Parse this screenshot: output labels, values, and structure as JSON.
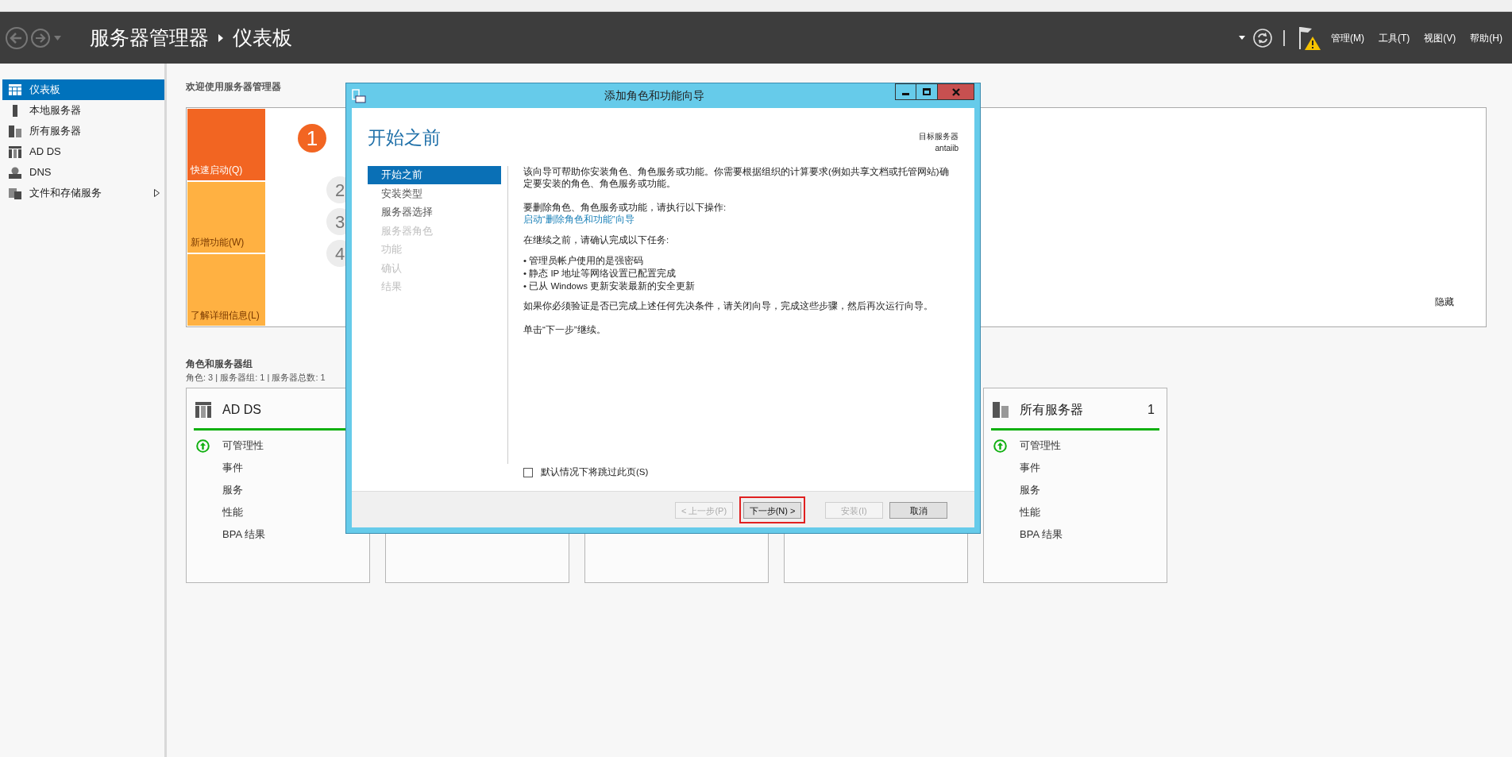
{
  "header": {
    "breadcrumb": [
      "服务器管理器",
      "仪表板"
    ],
    "menus": [
      "管理(M)",
      "工具(T)",
      "视图(V)",
      "帮助(H)"
    ]
  },
  "sidebar": {
    "items": [
      {
        "label": "仪表板",
        "selected": true,
        "expandable": false
      },
      {
        "label": "本地服务器",
        "selected": false,
        "expandable": false
      },
      {
        "label": "所有服务器",
        "selected": false,
        "expandable": false
      },
      {
        "label": "AD DS",
        "selected": false,
        "expandable": false
      },
      {
        "label": "DNS",
        "selected": false,
        "expandable": false
      },
      {
        "label": "文件和存储服务",
        "selected": false,
        "expandable": true
      }
    ]
  },
  "welcome": {
    "title": "欢迎使用服务器管理器",
    "quick_tiles": [
      {
        "label": "快速启动(Q)",
        "selected": true
      },
      {
        "label": "新增功能(W)",
        "selected": false
      },
      {
        "label": "了解详细信息(L)",
        "selected": false
      }
    ],
    "steps": [
      {
        "number": "1",
        "selected": true
      },
      {
        "number": "2",
        "selected": false
      },
      {
        "number": "3",
        "selected": false
      },
      {
        "number": "4",
        "selected": false
      }
    ],
    "hide_link": "隐藏"
  },
  "roles": {
    "title": "角色和服务器组",
    "summary": "角色: 3 | 服务器组: 1 | 服务器总数: 1",
    "tiles": [
      {
        "title": "AD DS",
        "rows": [
          {
            "label": "可管理性",
            "ok": true
          },
          {
            "label": "事件",
            "ok": false
          },
          {
            "label": "服务",
            "ok": false
          },
          {
            "label": "性能",
            "ok": false
          },
          {
            "label": "BPA 结果",
            "ok": false
          }
        ]
      },
      {
        "title": "所有服务器",
        "count": "1",
        "rows": [
          {
            "label": "可管理性",
            "ok": true
          },
          {
            "label": "事件",
            "ok": false
          },
          {
            "label": "服务",
            "ok": false
          },
          {
            "label": "性能",
            "ok": false
          },
          {
            "label": "BPA 结果",
            "ok": false
          }
        ]
      }
    ]
  },
  "dialog": {
    "title": "添加角色和功能向导",
    "heading": "开始之前",
    "target_label": "目标服务器",
    "target_name": "antaiib",
    "nav": [
      {
        "label": "开始之前",
        "selected": true,
        "disabled": false
      },
      {
        "label": "安装类型",
        "selected": false,
        "disabled": false
      },
      {
        "label": "服务器选择",
        "selected": false,
        "disabled": false
      },
      {
        "label": "服务器角色",
        "selected": false,
        "disabled": true
      },
      {
        "label": "功能",
        "selected": false,
        "disabled": true
      },
      {
        "label": "确认",
        "selected": false,
        "disabled": true
      },
      {
        "label": "结果",
        "selected": false,
        "disabled": true
      }
    ],
    "intro": "该向导可帮助你安装角色、角色服务或功能。你需要根据组织的计算要求(例如共享文档或托管网站)确定要安装的角色、角色服务或功能。",
    "remove_prompt": "要删除角色、角色服务或功能，请执行以下操作:",
    "remove_link": "启动“删除角色和功能”向导",
    "prereq_title": "在继续之前，请确认完成以下任务:",
    "bullets": [
      "• 管理员帐户使用的是强密码",
      "• 静态 IP 地址等网络设置已配置完成",
      "• 已从 Windows 更新安装最新的安全更新"
    ],
    "note": "如果你必须验证是否已完成上述任何先决条件，请关闭向导，完成这些步骤，然后再次运行向导。",
    "continue": "单击“下一步”继续。",
    "skip_checkbox": {
      "label": "默认情况下将跳过此页(S)",
      "checked": false
    },
    "buttons": [
      {
        "label": "< 上一步(P)",
        "disabled": true,
        "highlighted": false
      },
      {
        "label": "下一步(N) >",
        "disabled": false,
        "highlighted": true
      },
      {
        "label": "安装(I)",
        "disabled": true,
        "highlighted": false
      },
      {
        "label": "取消",
        "disabled": false,
        "highlighted": false
      }
    ]
  }
}
